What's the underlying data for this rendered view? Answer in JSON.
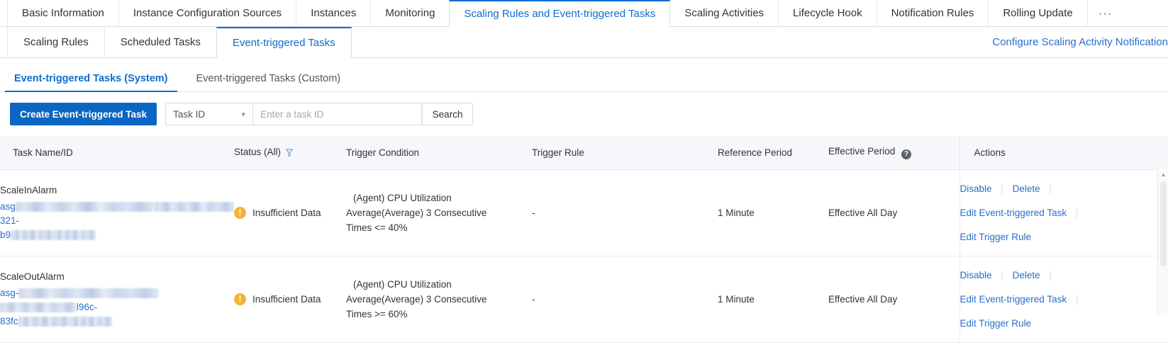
{
  "top_tabs": [
    {
      "label": "Basic Information",
      "active": false
    },
    {
      "label": "Instance Configuration Sources",
      "active": false
    },
    {
      "label": "Instances",
      "active": false
    },
    {
      "label": "Monitoring",
      "active": false
    },
    {
      "label": "Scaling Rules and Event-triggered Tasks",
      "active": true
    },
    {
      "label": "Scaling Activities",
      "active": false
    },
    {
      "label": "Lifecycle Hook",
      "active": false
    },
    {
      "label": "Notification Rules",
      "active": false
    },
    {
      "label": "Rolling Update",
      "active": false
    }
  ],
  "top_tabs_overflow": "···",
  "sub_tabs": [
    {
      "label": "Scaling Rules",
      "active": false
    },
    {
      "label": "Scheduled Tasks",
      "active": false
    },
    {
      "label": "Event-triggered Tasks",
      "active": true
    }
  ],
  "notification_link": "Configure Scaling Activity Notification",
  "inner_tabs": [
    {
      "label": "Event-triggered Tasks (System)",
      "active": true
    },
    {
      "label": "Event-triggered Tasks (Custom)",
      "active": false
    }
  ],
  "toolbar": {
    "create_label": "Create Event-triggered Task",
    "filter_select_value": "Task ID",
    "search_placeholder": "Enter a task ID",
    "search_value": "",
    "search_button": "Search"
  },
  "table": {
    "headers": {
      "name": "Task Name/ID",
      "status": "Status (All)",
      "condition": "Trigger Condition",
      "rule": "Trigger Rule",
      "reference": "Reference Period",
      "effective": "Effective Period",
      "actions": "Actions"
    },
    "rows": [
      {
        "task_name": "ScaleInAlarm",
        "task_id_prefix": "asg",
        "task_id_mid": "321-",
        "task_id_suffix": "b9",
        "status": "Insufficient Data",
        "status_icon": "warning-icon",
        "condition_line1": "(Agent)  CPU Utilization",
        "condition_line2": "Average(Average) 3 Consecutive",
        "condition_line3": "Times <= 40%",
        "trigger_rule": "-",
        "reference_period": "1 Minute",
        "effective_period": "Effective All Day",
        "actions": [
          "Disable",
          "Delete",
          "Edit Event-triggered Task",
          "Edit Trigger Rule"
        ]
      },
      {
        "task_name": "ScaleOutAlarm",
        "task_id_prefix": "asg-",
        "task_id_mid": "l96c-",
        "task_id_suffix": "83fc",
        "status": "Insufficient Data",
        "status_icon": "warning-icon",
        "condition_line1": "(Agent)  CPU Utilization",
        "condition_line2": "Average(Average) 3 Consecutive",
        "condition_line3": "Times >= 60%",
        "trigger_rule": "-",
        "reference_period": "1 Minute",
        "effective_period": "Effective All Day",
        "actions": [
          "Disable",
          "Delete",
          "Edit Event-triggered Task",
          "Edit Trigger Rule"
        ]
      }
    ]
  },
  "colors": {
    "accent": "#0a6ed1",
    "primary_button": "#0b66c3",
    "link": "#2a6ecb",
    "warning": "#f5b335",
    "header_bg": "#f5f7fa"
  }
}
